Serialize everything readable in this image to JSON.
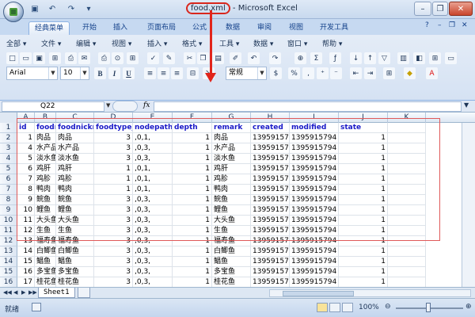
{
  "window": {
    "file_name": "food.xml",
    "title_rest": " - Microsoft Excel",
    "minimize": "–",
    "restore": "❐",
    "close": "✕"
  },
  "ribbon_tabs": [
    "经典菜单",
    "开始",
    "插入",
    "页面布局",
    "公式",
    "数据",
    "审阅",
    "视图",
    "开发工具"
  ],
  "help_icons": [
    "?",
    "–",
    "❐",
    "✕"
  ],
  "classic_menus": [
    "全部 ▾",
    "文件 ▾",
    "编辑 ▾",
    "视图 ▾",
    "插入 ▾",
    "格式 ▾",
    "工具 ▾",
    "数据 ▾",
    "窗口 ▾",
    "帮助 ▾"
  ],
  "format": {
    "font": "Arial",
    "size": "10",
    "bold": "B",
    "italic": "I",
    "underline": "U",
    "number_format": "常规",
    "percent": "%",
    "comma": ","
  },
  "formula_bar": {
    "cell_ref": "Q22",
    "fx": "fx",
    "value": ""
  },
  "columns": [
    "A",
    "B",
    "C",
    "D",
    "E",
    "F",
    "G",
    "H",
    "I",
    "J",
    "K"
  ],
  "rows": [
    [
      "id",
      "foodname",
      "foodnickn",
      "foodtype_",
      "nodepath",
      "depth",
      "remark",
      "created",
      "modified",
      "state",
      ""
    ],
    [
      "1",
      "肉品",
      "肉品",
      "3",
      ",0,1,",
      "1",
      "肉品",
      "1395915794",
      "1395915794",
      "1",
      ""
    ],
    [
      "4",
      "水产品",
      "水产品",
      "3",
      ",0,3,",
      "1",
      "水产品",
      "1395915794",
      "1395915794",
      "1",
      ""
    ],
    [
      "5",
      "淡水鱼",
      "淡水鱼",
      "3",
      ",0,3,",
      "1",
      "淡水鱼",
      "1395915794",
      "1395915794",
      "1",
      ""
    ],
    [
      "6",
      "鸡肝",
      "鸡肝",
      "1",
      ",0,1,",
      "1",
      "鸡肝",
      "1395915794",
      "1395915794",
      "1",
      ""
    ],
    [
      "7",
      "鸡胗",
      "鸡胗",
      "1",
      ",0,1,",
      "1",
      "鸡胗",
      "1395915794",
      "1395915794",
      "1",
      ""
    ],
    [
      "8",
      "鸭肉",
      "鸭肉",
      "1",
      ",0,1,",
      "1",
      "鸭肉",
      "1395915794",
      "1395915794",
      "1",
      ""
    ],
    [
      "9",
      "鲩鱼",
      "鲩鱼",
      "3",
      ",0,3,",
      "1",
      "鲩鱼",
      "1395915794",
      "1395915794",
      "1",
      ""
    ],
    [
      "10",
      "鲤鱼",
      "鲤鱼",
      "3",
      ",0,3,",
      "1",
      "鲤鱼",
      "1395915794",
      "1395915794",
      "1",
      ""
    ],
    [
      "11",
      "大头鱼",
      "大头鱼",
      "3",
      ",0,3,",
      "1",
      "大头鱼",
      "1395915794",
      "1395915794",
      "1",
      ""
    ],
    [
      "12",
      "生鱼",
      "生鱼",
      "3",
      ",0,3,",
      "1",
      "生鱼",
      "1395915794",
      "1395915794",
      "1",
      ""
    ],
    [
      "13",
      "福寿鱼",
      "福寿鱼",
      "3",
      ",0,3,",
      "1",
      "福寿鱼",
      "1395915794",
      "1395915794",
      "1",
      ""
    ],
    [
      "14",
      "白鲫鱼",
      "白鲫鱼",
      "3",
      ",0,3,",
      "1",
      "白鲫鱼",
      "1395915794",
      "1395915794",
      "1",
      ""
    ],
    [
      "15",
      "鲳鱼",
      "鲳鱼",
      "3",
      ",0,3,",
      "1",
      "鲳鱼",
      "1395915794",
      "1395915794",
      "1",
      ""
    ],
    [
      "16",
      "多宝鱼",
      "多宝鱼",
      "3",
      ",0,3,",
      "1",
      "多宝鱼",
      "1395915794",
      "1395915794",
      "1",
      ""
    ],
    [
      "17",
      "桂花鱼",
      "桂花鱼",
      "3",
      ",0,3,",
      "1",
      "桂花鱼",
      "1395915794",
      "1395915794",
      "1",
      ""
    ]
  ],
  "sheet_tab": "Sheet1",
  "status": {
    "ready": "就绪",
    "zoom": "100%",
    "zoom_out": "⊖",
    "zoom_in": "⊕"
  }
}
